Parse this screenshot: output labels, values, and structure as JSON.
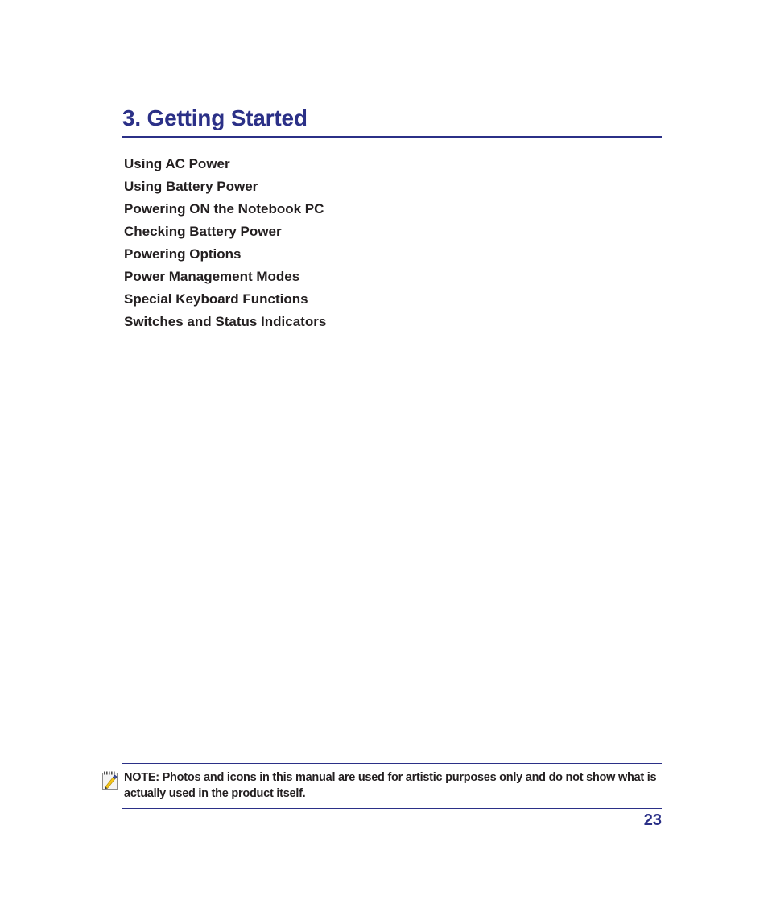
{
  "document": {
    "chapter": {
      "number": "3.",
      "title": "3. Getting Started"
    },
    "contents": [
      {
        "label": "Using AC Power"
      },
      {
        "label": "Using Battery Power"
      },
      {
        "label": "Powering ON the Notebook PC"
      },
      {
        "label": "Checking Battery Power"
      },
      {
        "label": "Powering Options"
      },
      {
        "label": "Power Management Modes"
      },
      {
        "label": "Special Keyboard Functions"
      },
      {
        "label": "Switches and Status Indicators"
      }
    ],
    "note": {
      "icon": "notepad-pencil-icon",
      "text": "NOTE: Photos and icons in this manual are used for artistic purposes only and do not show what is actually used in the product itself."
    },
    "page_number": "23",
    "colors": {
      "accent": "#2b3087",
      "body_text": "#231f20",
      "background": "#ffffff",
      "icon_pencil": "#f5c518",
      "icon_pencil_tip": "#2b3087",
      "icon_paper": "#f2f2f2",
      "icon_border": "#8a8a8a"
    }
  }
}
